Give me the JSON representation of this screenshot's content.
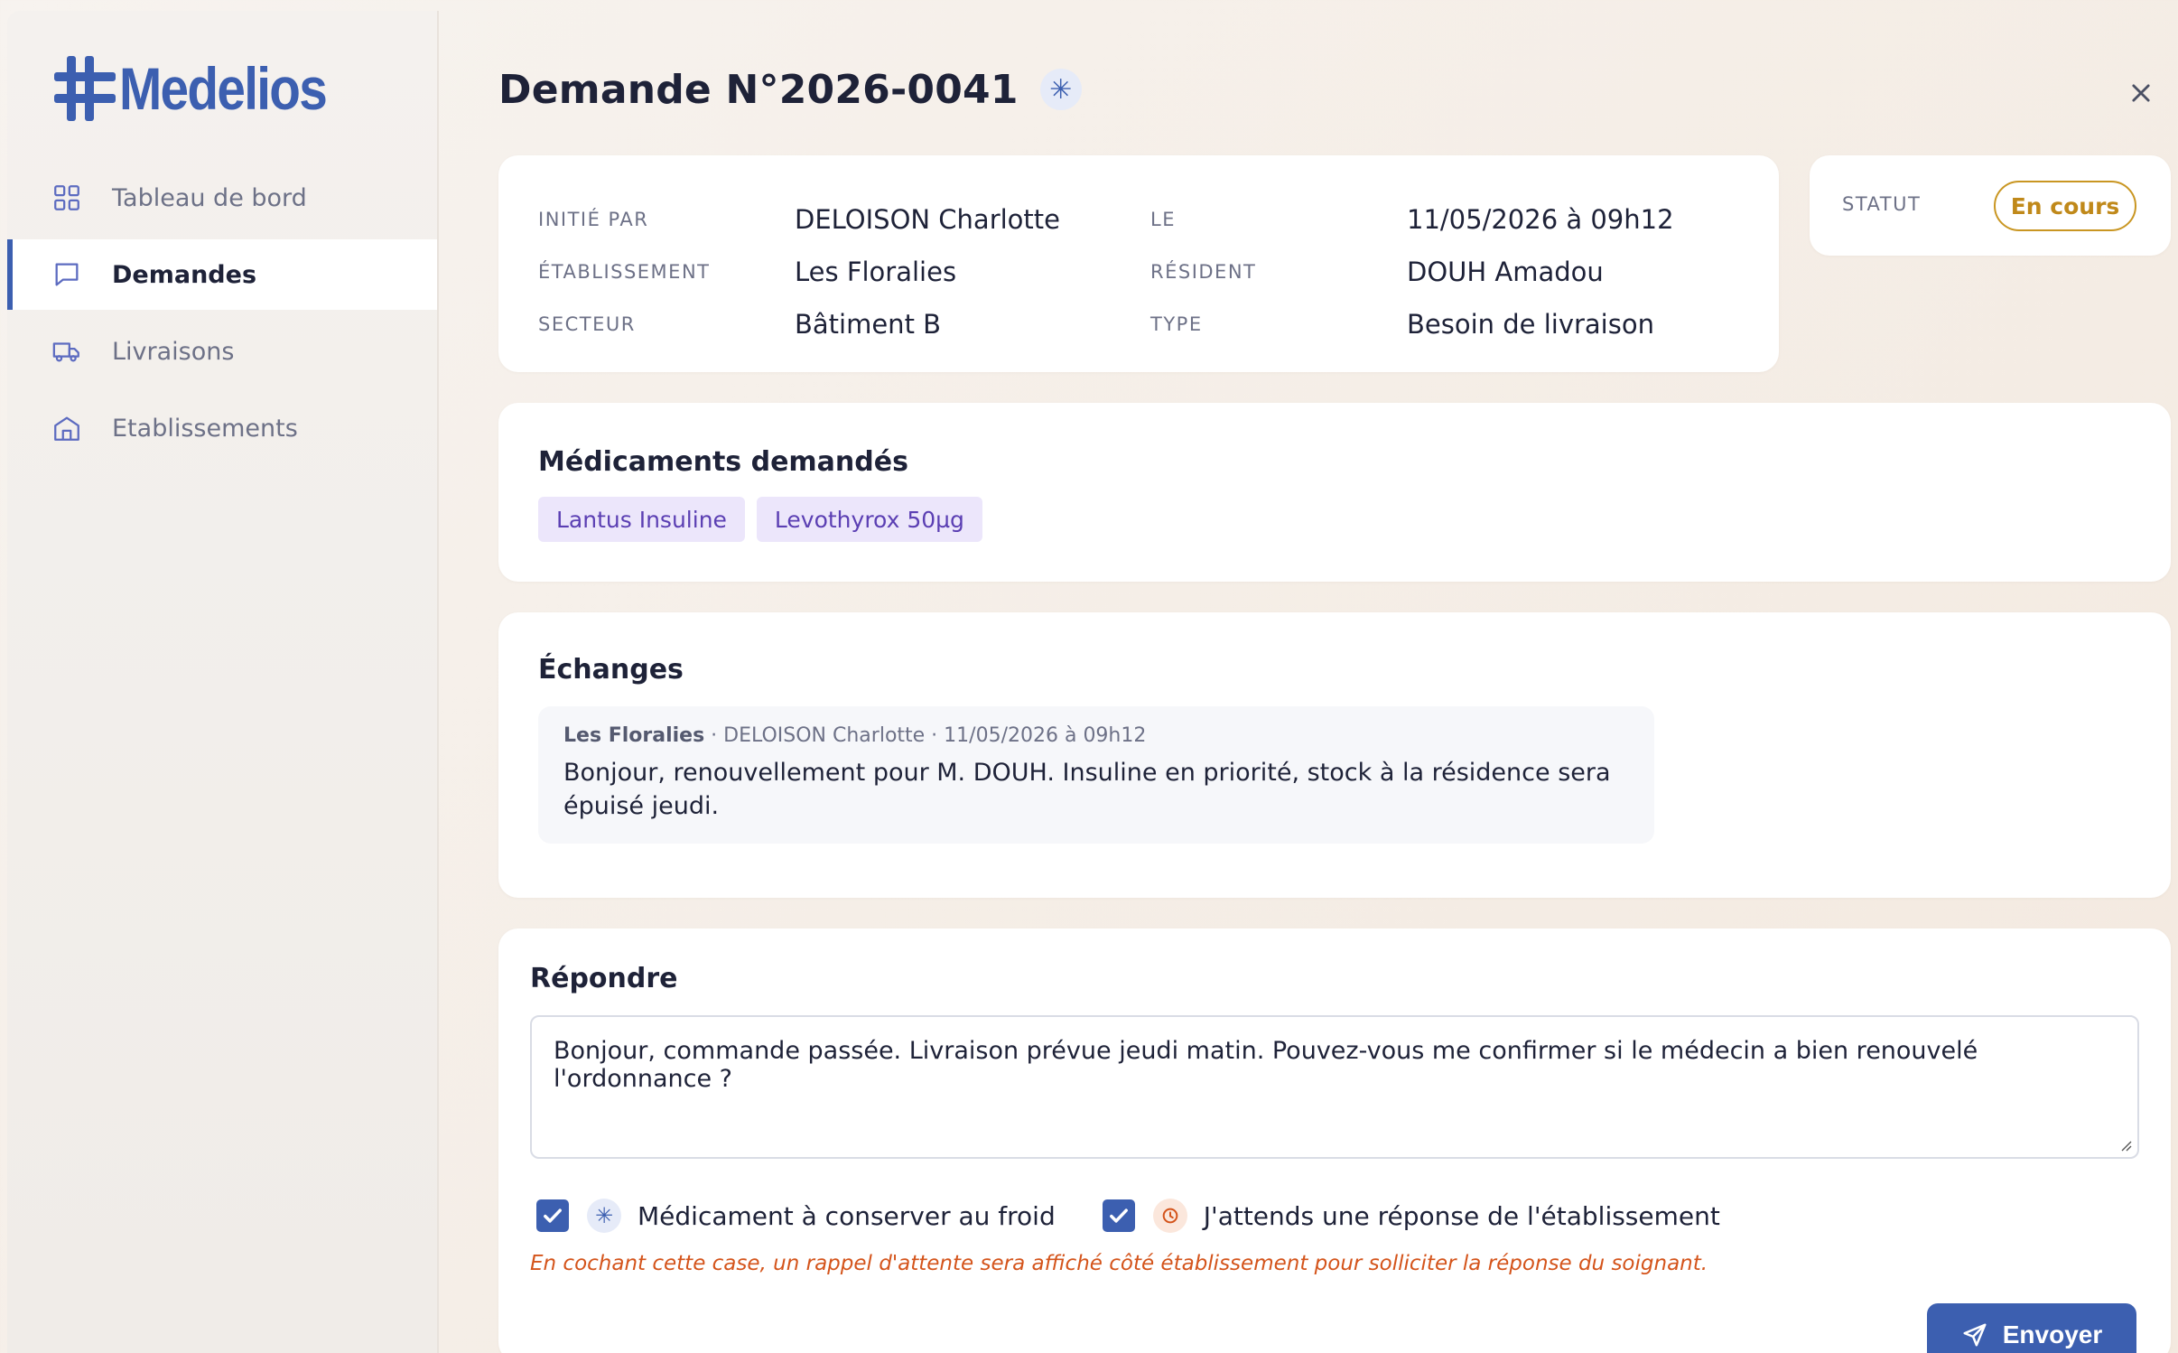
{
  "brand": {
    "name": "Medelios",
    "color": "#3c5fb0"
  },
  "sidebar": {
    "items": [
      {
        "label": "Tableau de bord",
        "icon": "grid-icon",
        "active": false
      },
      {
        "label": "Demandes",
        "icon": "chat-icon",
        "active": true
      },
      {
        "label": "Livraisons",
        "icon": "truck-icon",
        "active": false
      },
      {
        "label": "Etablissements",
        "icon": "building-icon",
        "active": false
      }
    ]
  },
  "header": {
    "title": "Demande N°2026-0041",
    "badge_icon": "snowflake-icon",
    "close_icon": "close-icon"
  },
  "info": {
    "initiated_by_label": "Initié par",
    "initiated_by": "DELOISON Charlotte",
    "date_label": "Le",
    "date": "11/05/2026 à 09h12",
    "facility_label": "Établissement",
    "facility": "Les Floralies",
    "resident_label": "Résident",
    "resident": "DOUH Amadou",
    "sector_label": "Secteur",
    "sector": "Bâtiment B",
    "type_label": "Type",
    "type": "Besoin de livraison"
  },
  "status": {
    "label": "Statut",
    "value": "En cours",
    "color": "#c99622"
  },
  "meds": {
    "title": "Médicaments demandés",
    "items": [
      "Lantus Insuline",
      "Levothyrox 50µg"
    ]
  },
  "exchanges": {
    "title": "Échanges",
    "messages": [
      {
        "facility": "Les Floralies",
        "meta": " · DELOISON Charlotte · 11/05/2026 à 09h12",
        "text": "Bonjour, renouvellement pour M. DOUH. Insuline en priorité, stock à la résidence sera épuisé jeudi."
      }
    ]
  },
  "reply": {
    "title": "Répondre",
    "value": "Bonjour, commande passée. Livraison prévue jeudi matin. Pouvez-vous me confirmer si le médecin a bien renouvelé l'ordonnance ?",
    "cold_label": "Médicament à conserver au froid",
    "cold_checked": true,
    "wait_label": "J'attends une réponse de l'établissement",
    "wait_checked": true,
    "hint": "En cochant cette case, un rappel d'attente sera affiché côté établissement pour solliciter la réponse du soignant.",
    "send_label": "Envoyer"
  }
}
